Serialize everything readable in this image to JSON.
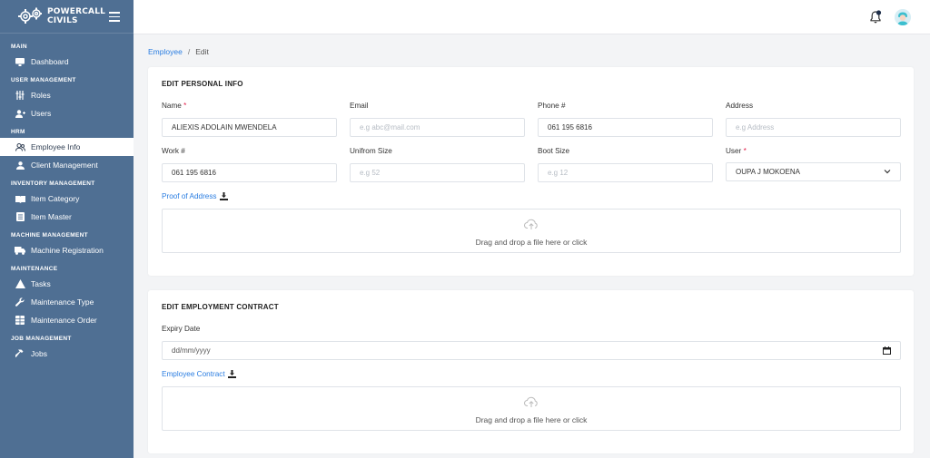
{
  "brand": {
    "line1": "POWERCALL",
    "line2": "CIVILS"
  },
  "sidebar": {
    "sections": [
      {
        "title": "MAIN",
        "items": [
          {
            "label": "Dashboard",
            "icon": "dashboard-icon"
          }
        ]
      },
      {
        "title": "USER MANAGEMENT",
        "items": [
          {
            "label": "Roles",
            "icon": "sliders-icon"
          },
          {
            "label": "Users",
            "icon": "user-plus-icon"
          }
        ]
      },
      {
        "title": "HRM",
        "items": [
          {
            "label": "Employee Info",
            "icon": "users-icon",
            "active": true
          },
          {
            "label": "Client Management",
            "icon": "user-icon"
          }
        ]
      },
      {
        "title": "INVENTORY MANAGEMENT",
        "items": [
          {
            "label": "Item Category",
            "icon": "book-icon"
          },
          {
            "label": "Item Master",
            "icon": "list-icon"
          }
        ]
      },
      {
        "title": "MACHINE MANAGEMENT",
        "items": [
          {
            "label": "Machine Registration",
            "icon": "truck-icon"
          }
        ]
      },
      {
        "title": "MAINTENANCE",
        "items": [
          {
            "label": "Tasks",
            "icon": "warning-icon"
          },
          {
            "label": "Maintenance Type",
            "icon": "wrench-icon"
          },
          {
            "label": "Maintenance Order",
            "icon": "table-icon"
          }
        ]
      },
      {
        "title": "JOB MANAGEMENT",
        "items": [
          {
            "label": "Jobs",
            "icon": "hammer-icon"
          }
        ]
      }
    ]
  },
  "breadcrumb": {
    "parent": "Employee",
    "current": "Edit"
  },
  "personal": {
    "title": "EDIT PERSONAL INFO",
    "name_label": "Name",
    "name_value": "ALIEXIS ADOLAIN MWENDELA",
    "email_label": "Email",
    "email_placeholder": "e.g abc@mail.com",
    "phone_label": "Phone #",
    "phone_value": "061 195 6816",
    "address_label": "Address",
    "address_placeholder": "e.g Address",
    "work_label": "Work #",
    "work_value": "061 195 6816",
    "uniform_label": "Unifrom Size",
    "uniform_placeholder": "e.g 52",
    "boot_label": "Boot Size",
    "boot_placeholder": "e.g 12",
    "user_label": "User",
    "user_value": "OUPA J MOKOENA",
    "proof_link": "Proof of Address",
    "dropzone_text": "Drag and drop a file here or click"
  },
  "contract": {
    "title": "EDIT EMPLOYMENT CONTRACT",
    "expiry_label": "Expiry Date",
    "expiry_placeholder": "dd/mm/yyyy",
    "contract_link": "Employee Contract",
    "dropzone_text": "Drag and drop a file here or click"
  },
  "required_mark": "*",
  "breadcrumb_sep": "/",
  "colors": {
    "sidebar": "#4f6f93",
    "link": "#2a7de1",
    "required": "#e11d48"
  }
}
